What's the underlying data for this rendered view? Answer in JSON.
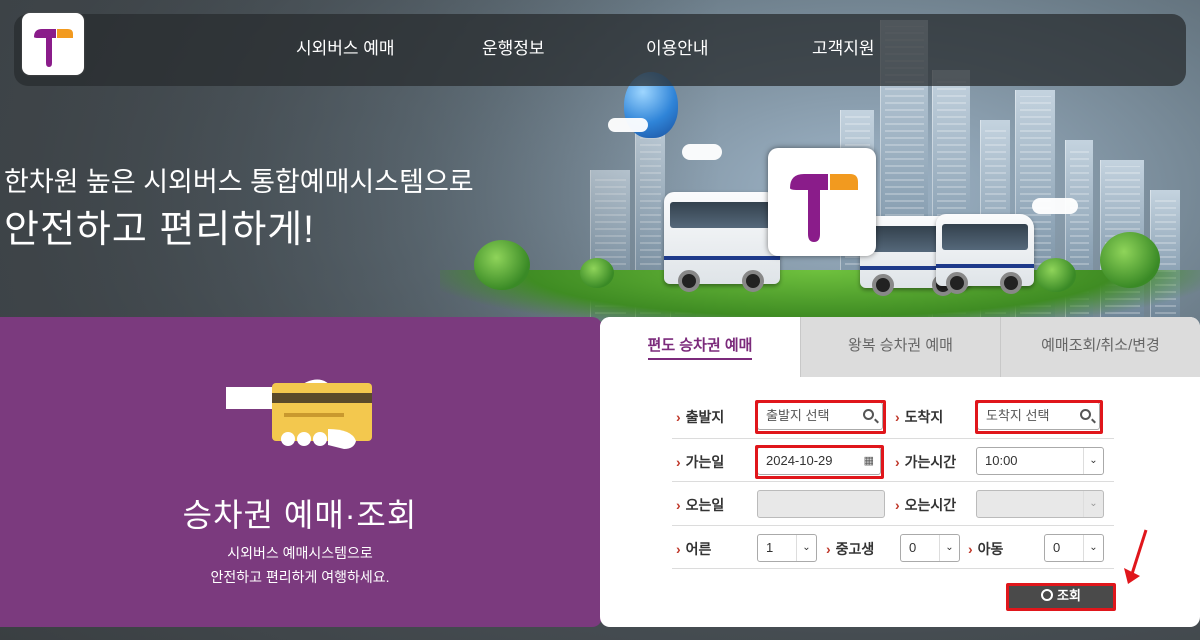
{
  "nav": {
    "items": [
      "시외버스 예매",
      "운행정보",
      "이용안내",
      "고객지원"
    ]
  },
  "hero": {
    "tagline_line1": "한차원 높은 시외버스 통합예매시스템으로",
    "tagline_line2": "안전하고 편리하게!"
  },
  "promo": {
    "title": "승차권 예매·조회",
    "subtitle_line1": "시외버스 예매시스템으로",
    "subtitle_line2": "안전하고 편리하게 여행하세요."
  },
  "tabs": [
    {
      "label": "편도 승차권 예매",
      "active": true
    },
    {
      "label": "왕복 승차권 예매",
      "active": false
    },
    {
      "label": "예매조회/취소/변경",
      "active": false
    }
  ],
  "form": {
    "departure_label": "출발지",
    "departure_placeholder": "출발지 선택",
    "arrival_label": "도착지",
    "arrival_placeholder": "도착지 선택",
    "go_date_label": "가는일",
    "go_date_value": "2024-10-29",
    "go_time_label": "가는시간",
    "go_time_value": "10:00",
    "return_date_label": "오는일",
    "return_time_label": "오는시간",
    "adult_label": "어른",
    "adult_value": "1",
    "teen_label": "중고생",
    "teen_value": "0",
    "child_label": "아동",
    "child_value": "0",
    "search_button": "조회"
  },
  "colors": {
    "brand_purple": "#7b3a7e",
    "brand_orange": "#f29a1f",
    "highlight_red": "#e0161b"
  }
}
